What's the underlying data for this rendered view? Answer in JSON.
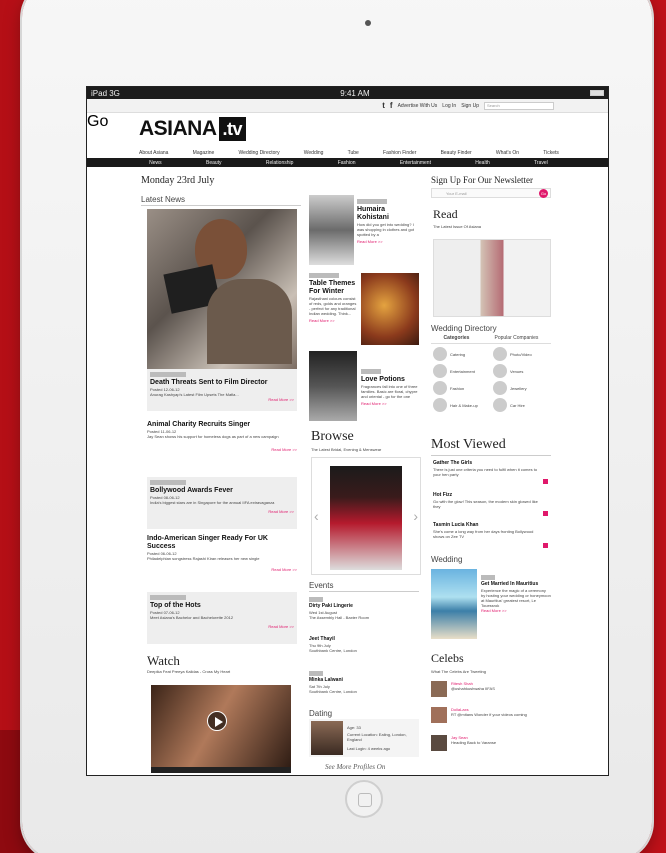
{
  "status": {
    "device": "iPad 3G",
    "time": "9:41 AM"
  },
  "topbar": {
    "links": [
      "Advertise With Us",
      "Log In",
      "Sign Up"
    ],
    "search_placeholder": "Search",
    "go": "Go"
  },
  "logo": {
    "main": "ASIANA",
    "tv": ".tv"
  },
  "nav": [
    "About Asiana",
    "Magazine",
    "Wedding Directory",
    "Wedding",
    "Tube",
    "Fashion Finder",
    "Beauty Finder",
    "What's On",
    "Tickets"
  ],
  "subnav": [
    "News",
    "Beauty",
    "Relationship",
    "Fashion",
    "Entertainment",
    "Health",
    "Travel"
  ],
  "date": "Monday 23rd July",
  "latest_news": "Latest News",
  "lead": {
    "title": "Death Threats Sent to Film Director",
    "posted": "Posted 12-06-12",
    "desc": "Anurag Kashyap's Latest Film Upsets The Mafia...",
    "readmore": "Read More >>"
  },
  "news": [
    {
      "title": "Animal Charity Recruits Singer",
      "posted": "Posted 11-06-12",
      "desc": "Jay Sean shows his support for homeless dogs as part of a new campaign",
      "readmore": "Read More >>"
    },
    {
      "title": "Bollywood Awards Fever",
      "posted": "Posted 08-06-12",
      "desc": "India's biggest stars are in Singapore for the annual IIFA extravaganza",
      "readmore": "Read More >>"
    },
    {
      "title": "Indo-American Singer Ready For UK Success",
      "posted": "Posted 06-06-12",
      "desc": "Philadelphian songstress Rajashi Kiran releases her new single",
      "readmore": "Read More >>"
    },
    {
      "title": "Top of the Hots",
      "posted": "Posted 07-06-12",
      "desc": "Meet Asiana's Bachelor and Bachelorette 2012",
      "readmore": "Read More >>"
    }
  ],
  "features": [
    {
      "title": "Humaira Kohistani",
      "desc": "How did you get into wedding? I was shopping in clothes and got spotted by a",
      "readmore": "Read More >>"
    },
    {
      "title": "Table Themes For Winter",
      "desc": "Rajasthani colours consist of reds, golds and oranges - perfect for any traditional Indian wedding. Think...",
      "readmore": "Read More >>"
    },
    {
      "title": "Love Potions",
      "desc": "Fragrances fall into one of three families. Basic are floral, chypre and oriental - go for the one",
      "readmore": "Read More >>"
    }
  ],
  "browse": {
    "title": "Browse",
    "subtitle": "The Latest Bridal, Evening & Menswear"
  },
  "events": {
    "title": "Events",
    "items": [
      {
        "name": "Dirty Paki Lingerie",
        "when": "Wed 1st August",
        "where": "The Assembly Hall - Baxter Room"
      },
      {
        "name": "Jeet Thayil",
        "when": "Thu 9th July",
        "where": "Southbank Centre, London"
      },
      {
        "name": "Minka Lalwani",
        "when": "Sat 7th July",
        "where": "Southbank Centre, London"
      }
    ]
  },
  "dating": {
    "title": "Dating",
    "age": "Age: 33",
    "location": "Current Location: Ealing, London, England",
    "login": "Last Login: 4 weeks ago",
    "more": "See More Profiles On"
  },
  "watch": {
    "title": "Watch",
    "subtitle": "Deepika Feat Preeya Kalidas - Cross My Heart"
  },
  "newsletter": {
    "title": "Sign Up For Our Newsletter",
    "placeholder": "Your E-mail",
    "go": "Go"
  },
  "read": {
    "title": "Read",
    "subtitle": "The Latest Issue Of Asiana"
  },
  "directory": {
    "title": "Wedding Directory",
    "tabs": [
      "Categories",
      "Popular Companies"
    ],
    "items": [
      "Catering",
      "Photo/Video",
      "Entertainment",
      "Venues",
      "Fashion",
      "Jewellery",
      "Hair & Make-up",
      "Car Hire"
    ]
  },
  "most_viewed": {
    "title": "Most Viewed",
    "items": [
      {
        "title": "Gather The Girls",
        "desc": "There is just one criteria you need to fulfil when it comes to your hen party"
      },
      {
        "title": "Hot Fizz",
        "desc": "Go with the glow! This season, the modern skin glowed like they"
      },
      {
        "title": "Tasmin Lucia Khan",
        "desc": "She's come a long way from her days fronting Bollywood shows on Zee TV"
      }
    ]
  },
  "wedding": {
    "title": "Wedding",
    "item": "Get Married In Mauritius",
    "desc": "Experience the magic of a ceremony by hosting your wedding or honeymoon at Mauritius' greatest resort, Le Touessrok",
    "readmore": "Read More >>"
  },
  "celebs": {
    "title": "Celebs",
    "subtitle": "What The Celebs Are Tweeting",
    "tweets": [
      {
        "name": "Ritesh Shah",
        "text": "@ushahkushwaha IIFAS"
      },
      {
        "name": "DollaLaxs",
        "text": "RT @mitans Wonder if your videos coming"
      },
      {
        "name": "Jay Sean",
        "text": "Heading Back to Varanse"
      }
    ]
  }
}
